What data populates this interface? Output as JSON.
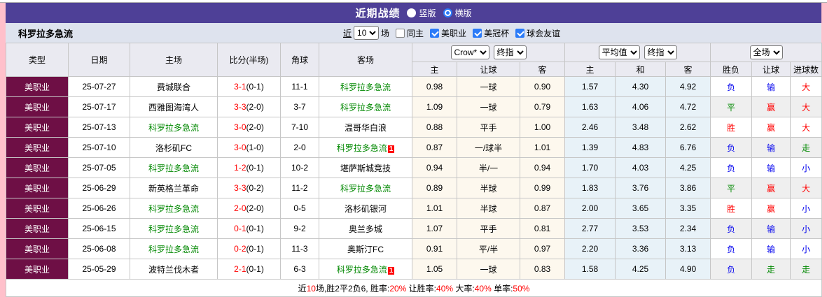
{
  "colors": {
    "accent_purple": "#4e4097",
    "league_maroon": "#6e0f45",
    "focus_team_green": "#008800",
    "win_red": "#ff0000",
    "lose_blue": "#0000ee",
    "page_pink": "#ffc0cb",
    "avg_col_blue": "#e8f2f8",
    "odds_col_cream": "#fdf8ee"
  },
  "title_bar": {
    "title": "近期战绩",
    "layout_options": [
      {
        "label": "竖版",
        "selected": false
      },
      {
        "label": "横版",
        "selected": true
      }
    ]
  },
  "team_bar": {
    "team": "科罗拉多急流",
    "near": "近",
    "match_count": "10",
    "unit": "场",
    "filters": [
      {
        "label": "同主",
        "checked": false
      },
      {
        "label": "美职业",
        "checked": true
      },
      {
        "label": "美冠杯",
        "checked": true
      },
      {
        "label": "球会友谊",
        "checked": true
      }
    ]
  },
  "table": {
    "main_headers": {
      "type": "类型",
      "date": "日期",
      "home": "主场",
      "score": "比分(半场)",
      "corner": "角球",
      "away": "客场"
    },
    "selects": {
      "odds_company": "Crow*",
      "odds_stage_1": "终指",
      "avg": "平均值",
      "odds_stage_2": "终指",
      "scope": "全场"
    },
    "sub_headers": [
      "主",
      "让球",
      "客",
      "主",
      "和",
      "客",
      "胜负",
      "让球",
      "进球数"
    ],
    "rows": [
      {
        "type": "美职业",
        "date": "25-07-27",
        "home": "费城联合",
        "home_green": false,
        "score_ft": "3-1",
        "score_ht": "(0-1)",
        "corner": "11-1",
        "away": "科罗拉多急流",
        "away_green": true,
        "badge": "",
        "odds": [
          "0.98",
          "一球",
          "0.90"
        ],
        "avg": [
          "1.57",
          "4.30",
          "4.92"
        ],
        "result": [
          {
            "t": "负",
            "c": "blue"
          },
          {
            "t": "输",
            "c": "blue"
          },
          {
            "t": "大",
            "c": "red"
          }
        ]
      },
      {
        "type": "美职业",
        "date": "25-07-17",
        "home": "西雅图海湾人",
        "home_green": false,
        "score_ft": "3-3",
        "score_ht": "(2-0)",
        "corner": "3-7",
        "away": "科罗拉多急流",
        "away_green": true,
        "badge": "",
        "odds": [
          "1.09",
          "一球",
          "0.79"
        ],
        "avg": [
          "1.63",
          "4.06",
          "4.72"
        ],
        "result": [
          {
            "t": "平",
            "c": "green"
          },
          {
            "t": "赢",
            "c": "red"
          },
          {
            "t": "大",
            "c": "red"
          }
        ]
      },
      {
        "type": "美职业",
        "date": "25-07-13",
        "home": "科罗拉多急流",
        "home_green": true,
        "score_ft": "3-0",
        "score_ht": "(2-0)",
        "corner": "7-10",
        "away": "温哥华白浪",
        "away_green": false,
        "badge": "",
        "odds": [
          "0.88",
          "平手",
          "1.00"
        ],
        "avg": [
          "2.46",
          "3.48",
          "2.62"
        ],
        "result": [
          {
            "t": "胜",
            "c": "red"
          },
          {
            "t": "赢",
            "c": "red"
          },
          {
            "t": "大",
            "c": "red"
          }
        ]
      },
      {
        "type": "美职业",
        "date": "25-07-10",
        "home": "洛杉矶FC",
        "home_green": false,
        "score_ft": "3-0",
        "score_ht": "(1-0)",
        "corner": "2-0",
        "away": "科罗拉多急流",
        "away_green": true,
        "badge": "1",
        "odds": [
          "0.87",
          "一/球半",
          "1.01"
        ],
        "avg": [
          "1.39",
          "4.83",
          "6.76"
        ],
        "result": [
          {
            "t": "负",
            "c": "blue"
          },
          {
            "t": "输",
            "c": "blue"
          },
          {
            "t": "走",
            "c": "green"
          }
        ]
      },
      {
        "type": "美职业",
        "date": "25-07-05",
        "home": "科罗拉多急流",
        "home_green": true,
        "score_ft": "1-2",
        "score_ht": "(0-1)",
        "corner": "10-2",
        "away": "堪萨斯城竞技",
        "away_green": false,
        "badge": "",
        "odds": [
          "0.94",
          "半/一",
          "0.94"
        ],
        "avg": [
          "1.70",
          "4.03",
          "4.25"
        ],
        "result": [
          {
            "t": "负",
            "c": "blue"
          },
          {
            "t": "输",
            "c": "blue"
          },
          {
            "t": "小",
            "c": "blue"
          }
        ]
      },
      {
        "type": "美职业",
        "date": "25-06-29",
        "home": "新英格兰革命",
        "home_green": false,
        "score_ft": "3-3",
        "score_ht": "(0-2)",
        "corner": "11-2",
        "away": "科罗拉多急流",
        "away_green": true,
        "badge": "",
        "odds": [
          "0.89",
          "半球",
          "0.99"
        ],
        "avg": [
          "1.83",
          "3.76",
          "3.86"
        ],
        "result": [
          {
            "t": "平",
            "c": "green"
          },
          {
            "t": "赢",
            "c": "red"
          },
          {
            "t": "大",
            "c": "red"
          }
        ]
      },
      {
        "type": "美职业",
        "date": "25-06-26",
        "home": "科罗拉多急流",
        "home_green": true,
        "score_ft": "2-0",
        "score_ht": "(2-0)",
        "corner": "0-5",
        "away": "洛杉矶银河",
        "away_green": false,
        "badge": "",
        "odds": [
          "1.01",
          "半球",
          "0.87"
        ],
        "avg": [
          "2.00",
          "3.65",
          "3.35"
        ],
        "result": [
          {
            "t": "胜",
            "c": "red"
          },
          {
            "t": "赢",
            "c": "red"
          },
          {
            "t": "小",
            "c": "blue"
          }
        ]
      },
      {
        "type": "美职业",
        "date": "25-06-15",
        "home": "科罗拉多急流",
        "home_green": true,
        "score_ft": "0-1",
        "score_ht": "(0-1)",
        "corner": "9-2",
        "away": "奥兰多城",
        "away_green": false,
        "badge": "",
        "odds": [
          "1.07",
          "平手",
          "0.81"
        ],
        "avg": [
          "2.77",
          "3.53",
          "2.34"
        ],
        "result": [
          {
            "t": "负",
            "c": "blue"
          },
          {
            "t": "输",
            "c": "blue"
          },
          {
            "t": "小",
            "c": "blue"
          }
        ]
      },
      {
        "type": "美职业",
        "date": "25-06-08",
        "home": "科罗拉多急流",
        "home_green": true,
        "score_ft": "0-2",
        "score_ht": "(0-1)",
        "corner": "11-3",
        "away": "奥斯汀FC",
        "away_green": false,
        "badge": "",
        "odds": [
          "0.91",
          "平/半",
          "0.97"
        ],
        "avg": [
          "2.20",
          "3.36",
          "3.13"
        ],
        "result": [
          {
            "t": "负",
            "c": "blue"
          },
          {
            "t": "输",
            "c": "blue"
          },
          {
            "t": "小",
            "c": "blue"
          }
        ]
      },
      {
        "type": "美职业",
        "date": "25-05-29",
        "home": "波特兰伐木者",
        "home_green": false,
        "score_ft": "2-1",
        "score_ht": "(0-1)",
        "corner": "6-3",
        "away": "科罗拉多急流",
        "away_green": true,
        "badge": "1",
        "odds": [
          "1.05",
          "一球",
          "0.83"
        ],
        "avg": [
          "1.58",
          "4.25",
          "4.90"
        ],
        "result": [
          {
            "t": "负",
            "c": "blue"
          },
          {
            "t": "走",
            "c": "green"
          },
          {
            "t": "走",
            "c": "green"
          }
        ]
      }
    ]
  },
  "footer": {
    "segments": [
      {
        "text": "近",
        "red": false
      },
      {
        "text": "10",
        "red": true
      },
      {
        "text": "场,胜2平2负6, 胜率:",
        "red": false
      },
      {
        "text": "20%",
        "red": true
      },
      {
        "text": " 让胜率:",
        "red": false
      },
      {
        "text": "40%",
        "red": true
      },
      {
        "text": " 大率:",
        "red": false
      },
      {
        "text": "40%",
        "red": true
      },
      {
        "text": " 单率:",
        "red": false
      },
      {
        "text": "50%",
        "red": true
      }
    ]
  }
}
